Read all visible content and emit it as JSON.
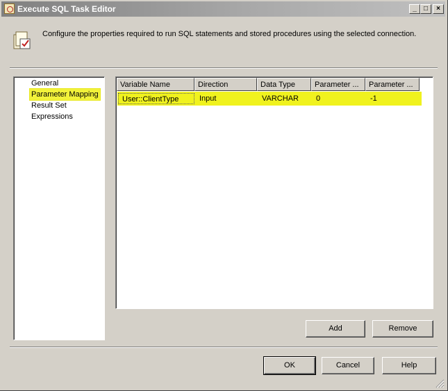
{
  "window": {
    "title": "Execute SQL Task Editor",
    "controls": {
      "minimize": "_",
      "maximize": "□",
      "close": "×"
    }
  },
  "header": {
    "description": "Configure the properties required to run SQL statements and stored procedures using the selected connection.",
    "icon": "sql-task-icon"
  },
  "nav": {
    "items": [
      {
        "label": "General",
        "selected": false
      },
      {
        "label": "Parameter Mapping",
        "selected": true
      },
      {
        "label": "Result Set",
        "selected": false
      },
      {
        "label": "Expressions",
        "selected": false
      }
    ]
  },
  "grid": {
    "columns": [
      "Variable Name",
      "Direction",
      "Data Type",
      "Parameter ...",
      "Parameter ..."
    ],
    "rows": [
      [
        "User::ClientType",
        "Input",
        "VARCHAR",
        "0",
        "-1"
      ]
    ],
    "highlight_color": "#f0f21e"
  },
  "buttons": {
    "add": "Add",
    "remove": "Remove",
    "ok": "OK",
    "cancel": "Cancel",
    "help": "Help"
  }
}
